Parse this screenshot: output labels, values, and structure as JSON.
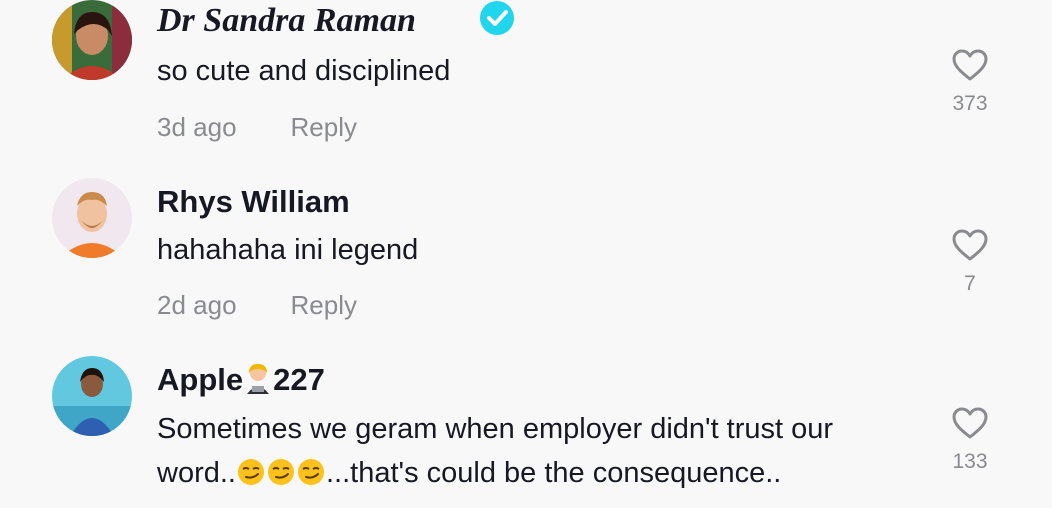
{
  "comments": [
    {
      "username": "Dr Sandra Raman",
      "verified": true,
      "text": "so cute and disciplined",
      "age": "3d ago",
      "reply_label": "Reply",
      "likes": "373"
    },
    {
      "username": "Rhys William",
      "verified": false,
      "text": "hahahaha ini legend",
      "age": "2d ago",
      "reply_label": "Reply",
      "likes": "7"
    },
    {
      "username_prefix": "Apple",
      "username_suffix": "227",
      "username_emoji": "woman-technologist-emoji",
      "verified": false,
      "text_line1": "Sometimes we geram when employer didn't trust our",
      "text_line2_prefix": "word..",
      "text_line2_emoji": "smirking-face-emoji",
      "text_line2_suffix": "...that's could be the consequence..",
      "likes": "133"
    }
  ],
  "colors": {
    "background": "#f8f8f8",
    "text": "#161823",
    "muted": "#8a8b91",
    "verified": "#20d5ec"
  }
}
